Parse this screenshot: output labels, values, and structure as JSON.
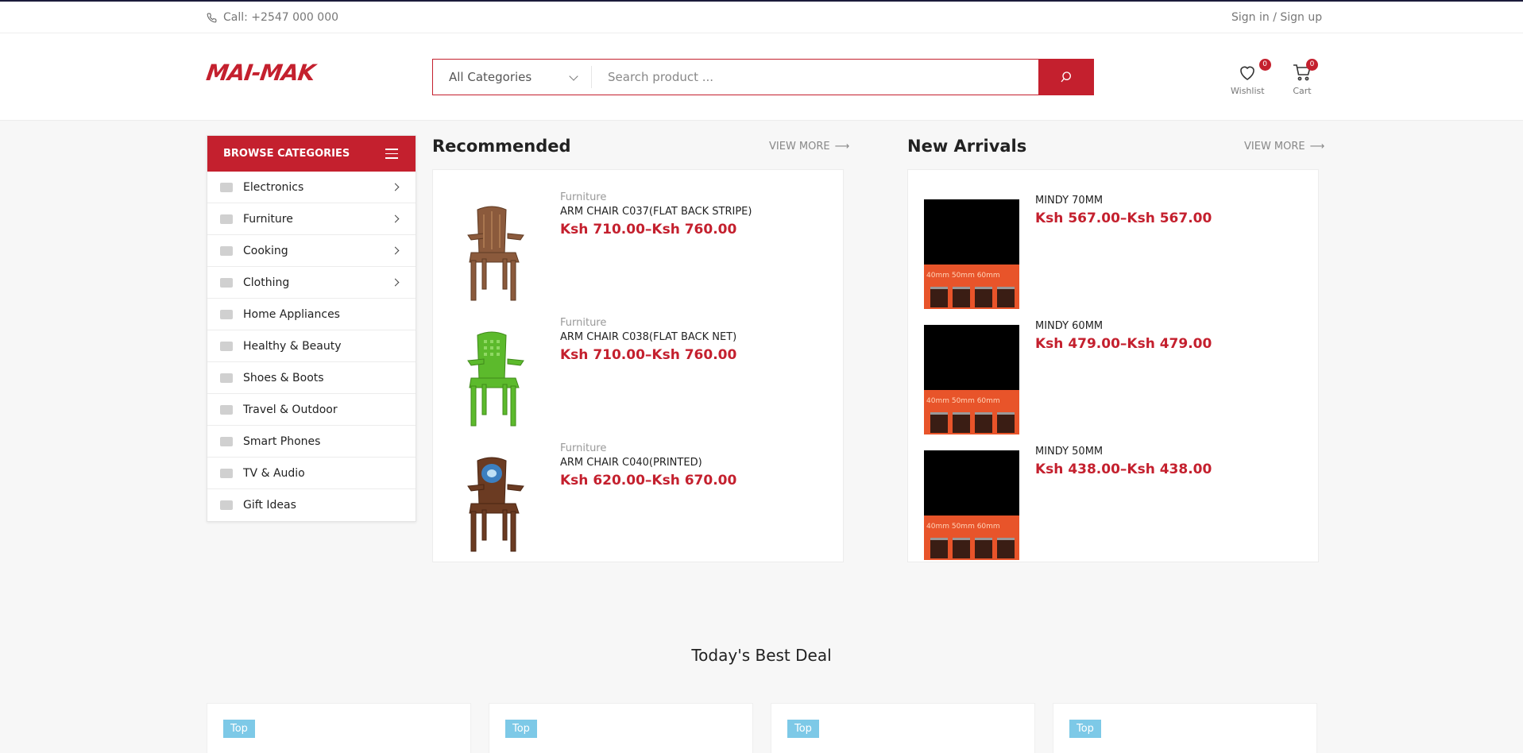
{
  "topbar": {
    "call": "Call: +2547 000 000",
    "signin": "Sign in",
    "separator": "/",
    "signup": "Sign up"
  },
  "header": {
    "logo": "MAI-MAK",
    "category_select": "All Categories",
    "search_placeholder": "Search product ...",
    "wishlist_label": "Wishlist",
    "wishlist_count": "0",
    "cart_label": "Cart",
    "cart_count": "0"
  },
  "sidebar": {
    "title": "BROWSE CATEGORIES",
    "items": [
      {
        "label": "Electronics",
        "icon": "laptop-icon",
        "has_submenu": true
      },
      {
        "label": "Furniture",
        "icon": "sofa-icon",
        "has_submenu": true
      },
      {
        "label": "Cooking",
        "icon": "cooking-icon",
        "has_submenu": true
      },
      {
        "label": "Clothing",
        "icon": "shirt-icon",
        "has_submenu": true
      },
      {
        "label": "Home Appliances",
        "icon": "appliance-icon",
        "has_submenu": false
      },
      {
        "label": "Healthy & Beauty",
        "icon": "heart-icon",
        "has_submenu": false
      },
      {
        "label": "Shoes & Boots",
        "icon": "shoe-icon",
        "has_submenu": false
      },
      {
        "label": "Travel & Outdoor",
        "icon": "signpost-icon",
        "has_submenu": false
      },
      {
        "label": "Smart Phones",
        "icon": "phone-icon",
        "has_submenu": false
      },
      {
        "label": "TV & Audio",
        "icon": "tv-icon",
        "has_submenu": false
      },
      {
        "label": "Gift Ideas",
        "icon": "gift-icon",
        "has_submenu": false
      }
    ]
  },
  "recommended": {
    "title": "Recommended",
    "view_more": "VIEW MORE",
    "products": [
      {
        "category": "Furniture",
        "name": "ARM CHAIR C037(FLAT BACK STRIPE)",
        "price": "Ksh 710.00–Ksh 760.00",
        "image": "brown-plastic-chair"
      },
      {
        "category": "Furniture",
        "name": "ARM CHAIR C038(FLAT BACK NET)",
        "price": "Ksh 710.00–Ksh 760.00",
        "image": "green-plastic-chair"
      },
      {
        "category": "Furniture",
        "name": "ARM CHAIR C040(PRINTED)",
        "price": "Ksh 620.00–Ksh 670.00",
        "image": "printed-brown-chair"
      }
    ]
  },
  "new_arrivals": {
    "title": "New Arrivals",
    "view_more": "VIEW MORE",
    "products": [
      {
        "name": "MINDY 70MM",
        "price": "Ksh 567.00–Ksh 567.00",
        "image_text": "40mm 50mm 60mm"
      },
      {
        "name": "MINDY 60MM",
        "price": "Ksh 479.00–Ksh 479.00",
        "image_text": "40mm 50mm 60mm"
      },
      {
        "name": "MINDY 50MM",
        "price": "Ksh 438.00–Ksh 438.00",
        "image_text": "40mm 50mm 60mm"
      }
    ]
  },
  "best_deal": {
    "title": "Today's Best Deal",
    "cards": [
      {
        "tag": "Top"
      },
      {
        "tag": "Top"
      },
      {
        "tag": "Top"
      },
      {
        "tag": "Top"
      }
    ]
  },
  "colors": {
    "accent": "#c4202e",
    "tag": "#7dc9e7",
    "background": "#f7f7f7"
  }
}
